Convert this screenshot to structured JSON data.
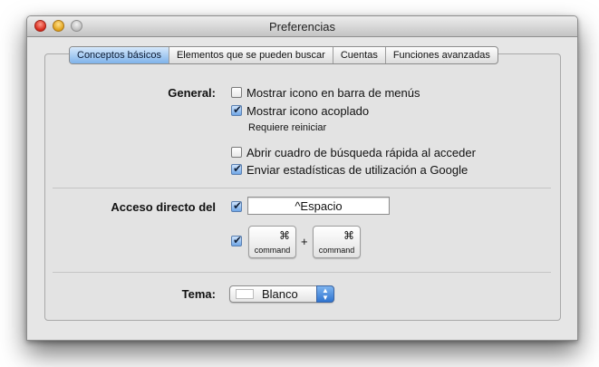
{
  "window": {
    "title": "Preferencias"
  },
  "tabs": [
    {
      "label": "Conceptos básicos",
      "active": true
    },
    {
      "label": "Elementos que se pueden buscar",
      "active": false
    },
    {
      "label": "Cuentas",
      "active": false
    },
    {
      "label": "Funciones avanzadas",
      "active": false
    }
  ],
  "general": {
    "label": "General:",
    "options": [
      {
        "label": "Mostrar icono en barra de menús",
        "checked": false
      },
      {
        "label": "Mostrar icono acoplado",
        "checked": true
      },
      {
        "label": "Abrir cuadro de búsqueda rápida al acceder",
        "checked": false
      },
      {
        "label": "Enviar estadísticas de utilización a Google",
        "checked": true
      }
    ],
    "note": "Requiere reiniciar"
  },
  "shortcut": {
    "label": "Acceso directo del",
    "option1_checked": true,
    "field_value": "^Espacio",
    "option2_checked": true,
    "key1": {
      "symbol": "⌘",
      "name": "command"
    },
    "plus": "+",
    "key2": {
      "symbol": "⌘",
      "name": "command"
    }
  },
  "theme": {
    "label": "Tema:",
    "value": "Blanco",
    "swatch_color": "#ffffff"
  },
  "colors": {
    "accent": "#6fa6e6",
    "close_button": "#d6281a",
    "minimize_button": "#e0a11a",
    "zoom_button": "#bdbdbd"
  }
}
